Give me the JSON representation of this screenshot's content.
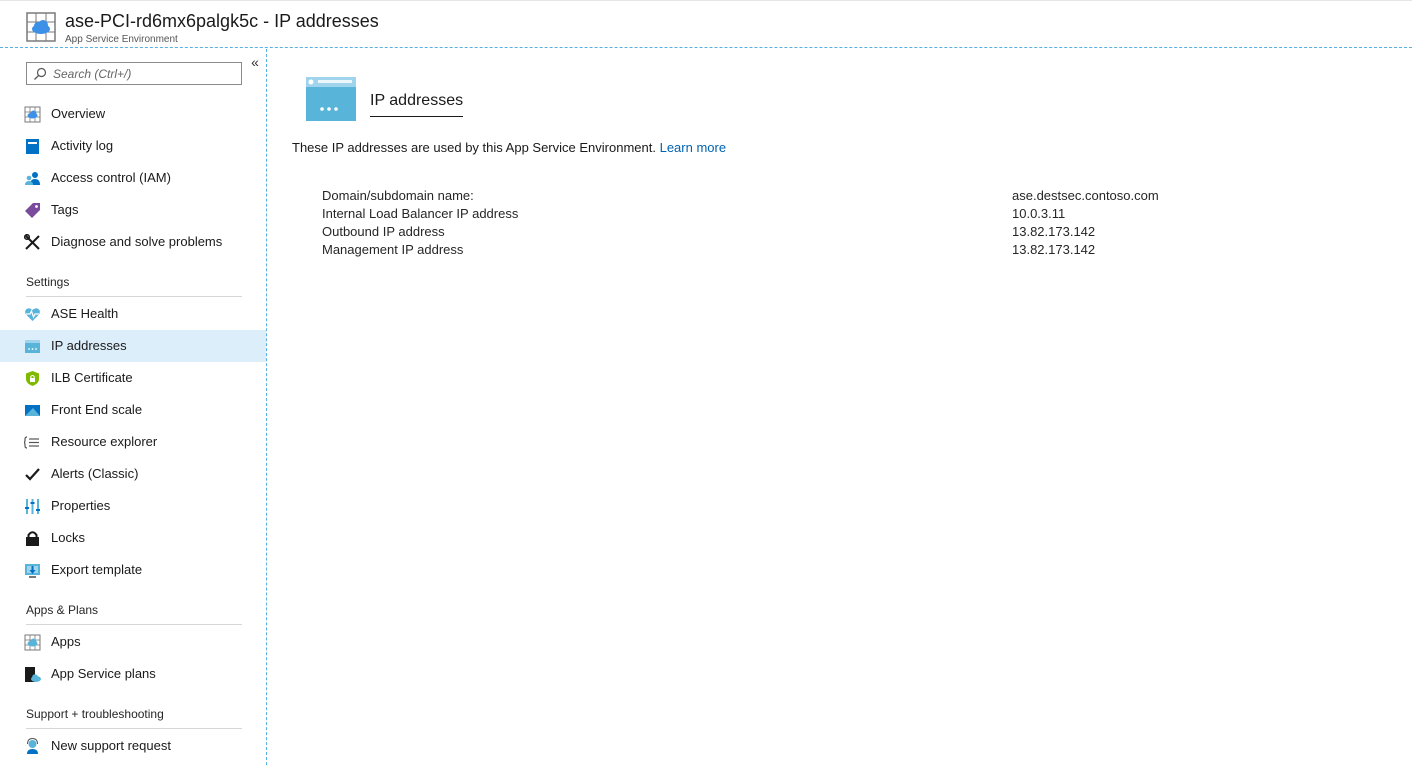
{
  "header": {
    "title": "ase-PCI-rd6mx6palgk5c - IP addresses",
    "subtitle": "App Service Environment"
  },
  "sidebar": {
    "search_placeholder": "Search (Ctrl+/)",
    "collapse_label": "«",
    "top_items": [
      {
        "label": "Overview",
        "icon": "app-service-environment-icon"
      },
      {
        "label": "Activity log",
        "icon": "activity-log-icon"
      },
      {
        "label": "Access control (IAM)",
        "icon": "people-icon"
      },
      {
        "label": "Tags",
        "icon": "tag-icon"
      },
      {
        "label": "Diagnose and solve problems",
        "icon": "wrench-icon"
      }
    ],
    "sections": [
      {
        "title": "Settings",
        "items": [
          {
            "label": "ASE Health",
            "icon": "heart-pulse-icon"
          },
          {
            "label": "IP addresses",
            "icon": "ip-window-icon",
            "selected": true
          },
          {
            "label": "ILB Certificate",
            "icon": "shield-lock-icon"
          },
          {
            "label": "Front End scale",
            "icon": "scale-icon"
          },
          {
            "label": "Resource explorer",
            "icon": "resource-explorer-icon"
          },
          {
            "label": "Alerts (Classic)",
            "icon": "checkmark-icon"
          },
          {
            "label": "Properties",
            "icon": "properties-icon"
          },
          {
            "label": "Locks",
            "icon": "lock-icon"
          },
          {
            "label": "Export template",
            "icon": "export-template-icon"
          }
        ]
      },
      {
        "title": "Apps & Plans",
        "items": [
          {
            "label": "Apps",
            "icon": "apps-icon"
          },
          {
            "label": "App Service plans",
            "icon": "app-service-plan-icon"
          }
        ]
      },
      {
        "title": "Support + troubleshooting",
        "items": [
          {
            "label": "New support request",
            "icon": "support-request-icon"
          }
        ]
      }
    ]
  },
  "main": {
    "title": "IP addresses",
    "description": "These IP addresses are used by this App Service Environment.",
    "learn_more": "Learn more",
    "properties": [
      {
        "label": "Domain/subdomain name:",
        "value": "ase.destsec.contoso.com"
      },
      {
        "label": "Internal Load Balancer IP address",
        "value": "10.0.3.11"
      },
      {
        "label": "Outbound IP address",
        "value": "13.82.173.142"
      },
      {
        "label": "Management IP address",
        "value": "13.82.173.142"
      }
    ]
  },
  "colors": {
    "accent": "#0063b1",
    "selected_bg": "#ddeefb",
    "dashed_border": "#58b0e0",
    "icon_blue": "#59b4d9"
  }
}
